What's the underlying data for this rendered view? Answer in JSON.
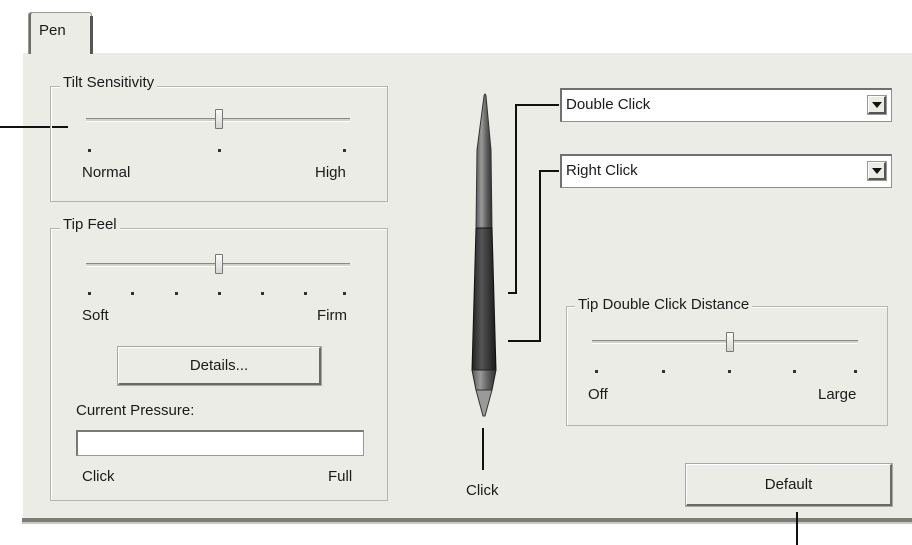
{
  "tabs": [
    {
      "label": "Pen",
      "active": true
    }
  ],
  "tilt": {
    "title": "Tilt Sensitivity",
    "min_label": "Normal",
    "max_label": "High",
    "value": 0.5
  },
  "tip_feel": {
    "title": "Tip Feel",
    "min_label": "Soft",
    "max_label": "Firm",
    "value": 0.5,
    "details_label": "Details...",
    "pressure_label": "Current Pressure:",
    "pressure_min": "Click",
    "pressure_max": "Full",
    "pressure_value": 0
  },
  "pen": {
    "upper_button": "Double Click",
    "lower_button": "Right Click",
    "tip_label": "Click"
  },
  "tip_double_click": {
    "title": "Tip Double Click Distance",
    "min_label": "Off",
    "max_label": "Large",
    "value": 0.5
  },
  "default_label": "Default",
  "colors": {
    "panel": "#ecece6",
    "pen_body": "#3a3a3a"
  }
}
